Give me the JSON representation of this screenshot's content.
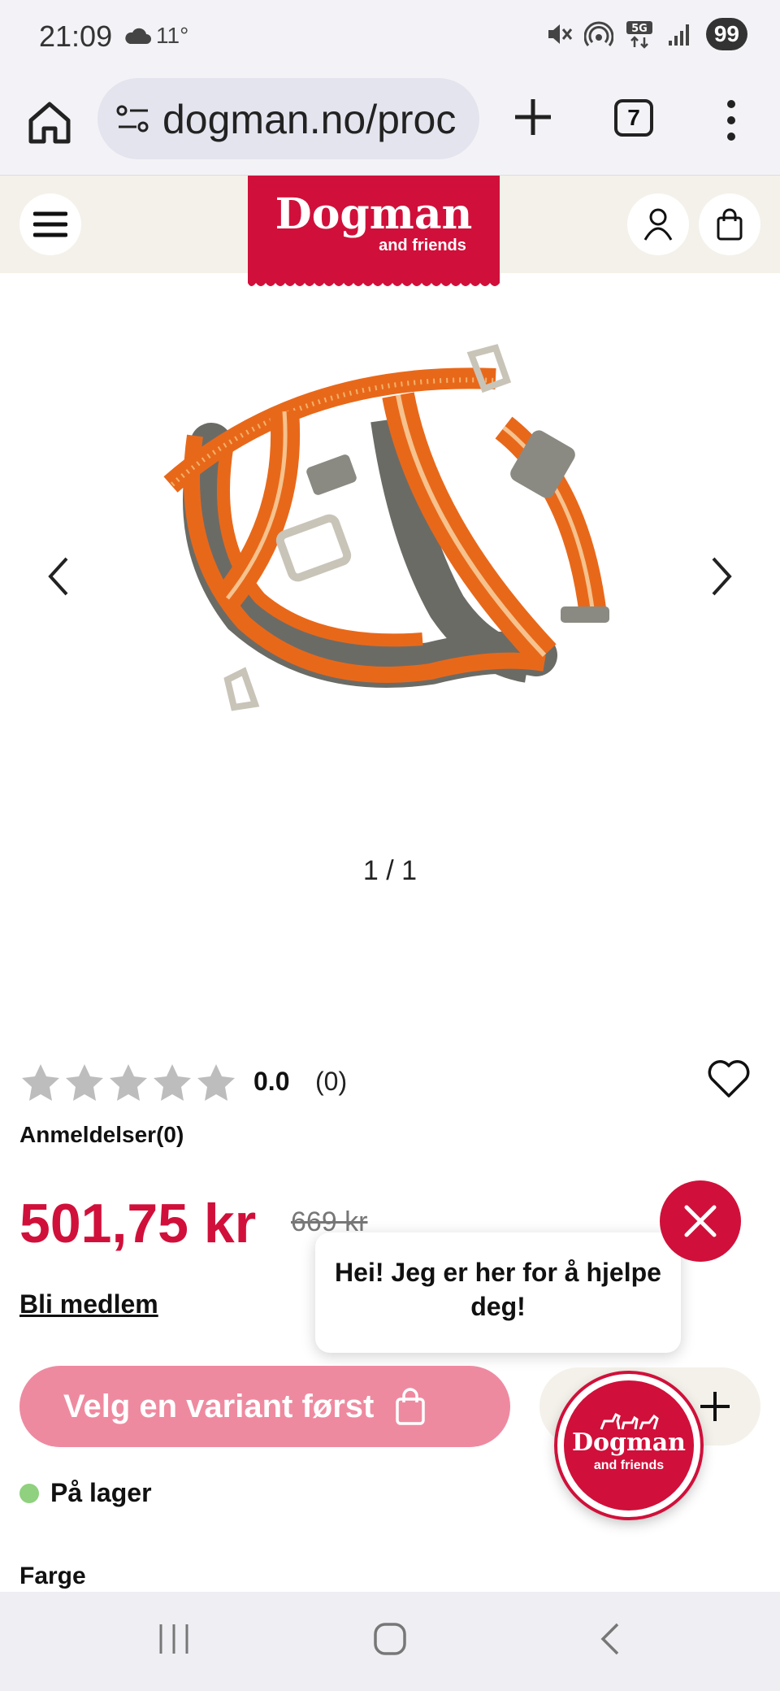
{
  "status_bar": {
    "time": "21:09",
    "temperature": "11°",
    "battery": "99",
    "network": "5G"
  },
  "browser": {
    "url": "dogman.no/proc",
    "tab_count": "7"
  },
  "site": {
    "logo_main": "Dogman",
    "logo_sub": "and friends"
  },
  "gallery": {
    "pager": "1 / 1",
    "product_colors": [
      "#e8681a",
      "#5a5a5a",
      "#c9c4b8"
    ]
  },
  "product": {
    "rating_value": "0.0",
    "rating_count": "(0)",
    "rating_stars": 0,
    "reviews_label": "Anmeldelser(0)",
    "price": "501,75 kr",
    "old_price": "669 kr",
    "member_link": "Bli medlem",
    "variant_button": "Velg en variant først",
    "stock_status": "På lager",
    "color_label": "Farge"
  },
  "chat": {
    "greeting": "Hei! Jeg er her for å hjelpe deg!",
    "launcher_main": "Dogman",
    "launcher_sub": "and friends"
  },
  "colors": {
    "brand_red": "#d0103a",
    "button_pink": "#ee8aa0",
    "header_bg": "#f4f1ea",
    "in_stock": "#8fd17e"
  }
}
